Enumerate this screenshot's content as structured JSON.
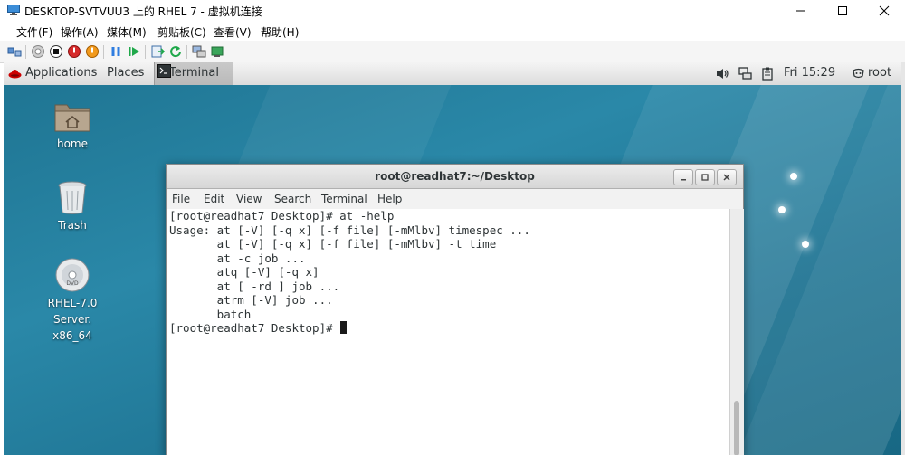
{
  "host": {
    "title": "DESKTOP-SVTVUU3 上的 RHEL 7 - 虚拟机连接",
    "menu": [
      "文件(F)",
      "操作(A)",
      "媒体(M)",
      "剪贴板(C)",
      "查看(V)",
      "帮助(H)"
    ],
    "toolbar_icons": [
      "ctrl-alt-del-icon",
      "start-icon",
      "stop-icon",
      "shutdown-icon",
      "power-icon",
      "pause-icon",
      "resume-icon",
      "checkpoint-icon",
      "revert-icon",
      "enhanced-session-icon",
      "share-icon"
    ]
  },
  "gnome": {
    "applications": "Applications",
    "places": "Places",
    "task": "Terminal",
    "clock": "Fri 15:29",
    "user": "root"
  },
  "desktop": {
    "icons": [
      {
        "label": "home"
      },
      {
        "label": "Trash"
      },
      {
        "label": "RHEL-7.0 Server.",
        "label2": "x86_64"
      }
    ]
  },
  "terminal": {
    "title": "root@readhat7:~/Desktop",
    "menu": [
      "File",
      "Edit",
      "View",
      "Search",
      "Terminal",
      "Help"
    ],
    "lines": [
      "[root@readhat7 Desktop]# at -help",
      "Usage: at [-V] [-q x] [-f file] [-mMlbv] timespec ...",
      "       at [-V] [-q x] [-f file] [-mMlbv] -t time",
      "       at -c job ...",
      "       atq [-V] [-q x]",
      "       at [ -rd ] job ...",
      "       atrm [-V] job ...",
      "       batch",
      "[root@readhat7 Desktop]# "
    ]
  },
  "colors": {
    "desktop": "#1f7593",
    "accent_red": "#cc0000"
  }
}
